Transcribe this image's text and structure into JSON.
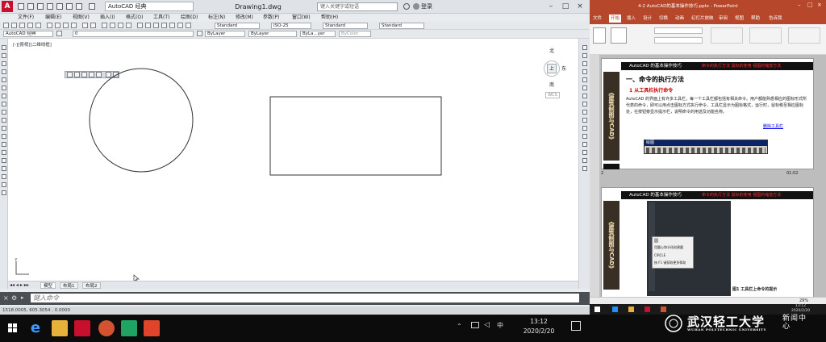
{
  "acad": {
    "workspace": "AutoCAD 经典",
    "doc_title": "Drawing1.dwg",
    "search_placeholder": "键入关键字或短语",
    "login": "登录",
    "menu": [
      "文件(F)",
      "编辑(E)",
      "视图(V)",
      "插入(I)",
      "格式(O)",
      "工具(T)",
      "绘图(D)",
      "标注(N)",
      "修改(M)",
      "参数(P)",
      "窗口(W)",
      "帮助(H)"
    ],
    "toolbar2": {
      "ws": "AutoCAD 经典",
      "layer": "0",
      "style1": "Standard",
      "dimstyle": "ISO-25",
      "style2": "Standard",
      "style3": "Standard"
    },
    "props": {
      "color": "ByLayer",
      "linetype": "ByLayer",
      "lineweight": "ByLa...yer",
      "plot": "ByColor"
    },
    "viewport_label": "[-][俯视][二维线框]",
    "viewcube": {
      "north": "北",
      "south": "南",
      "east": "东",
      "top": "上",
      "wcs": "WCS"
    },
    "tabs": [
      "模型",
      "布局1",
      "布局2"
    ],
    "command_placeholder": "键入命令",
    "coords": "1518.0005, 605.3054 , 0.0000"
  },
  "taskbar": {
    "time": "13:12",
    "date": "2020/2/20",
    "ime": "中"
  },
  "ppt": {
    "title": "4-2 AutoCAD的基本操作技巧.pptx - PowerPoint",
    "tabs": [
      "文件",
      "开始",
      "插入",
      "设计",
      "切换",
      "动画",
      "幻灯片放映",
      "审阅",
      "视图",
      "帮助",
      "告诉我"
    ],
    "slide1": {
      "header": "AutoCAD 的基本操作技巧",
      "header_sub": "命令的执行方法   鼠标的使用   视图的缩放方法",
      "vertical": "《建筑制图与CAD》",
      "section": "一、命令的执行方法",
      "subsection": "1 从工具栏执行命令",
      "body": "AutoCAD 的界面上有许多工具栏，每一个工具栏都包括有相关命令。用户都能熟悉相应的图标形式所代表的命令，即可以用点击图标方式执行命令。工具栏显示为图标格式，运行时，鼠标移至相应图标处，在按钮旁显示提示栏，说明命令的用途及功能名称。",
      "link": "删除工具栏",
      "toolbar_title": "绘图",
      "number": "2",
      "time": "01:02"
    },
    "slide2": {
      "header": "AutoCAD 的基本操作技巧",
      "header_sub": "命令的执行方法   鼠标的使用   视图的缩放方法",
      "vertical": "《建筑制图与CAD》",
      "menu1": "圆",
      "menu2": "用圆心和半径创建圆",
      "menu3": "CIRCLE",
      "menu4": "按 F1 键获取更多帮助",
      "caption": "图1 工具栏上命令的提示"
    },
    "status_zoom": "29%",
    "time": "13:12",
    "date": "2020/2/20"
  },
  "watermark": {
    "cn": "武汉轻工大学",
    "en": "WUHAN POLYTECHNIC UNIVERSITY",
    "news": "新闻中心"
  },
  "colors": {
    "acad_red": "#c8102e",
    "ppt_red": "#b7472a",
    "canvas": "#ffffff"
  }
}
